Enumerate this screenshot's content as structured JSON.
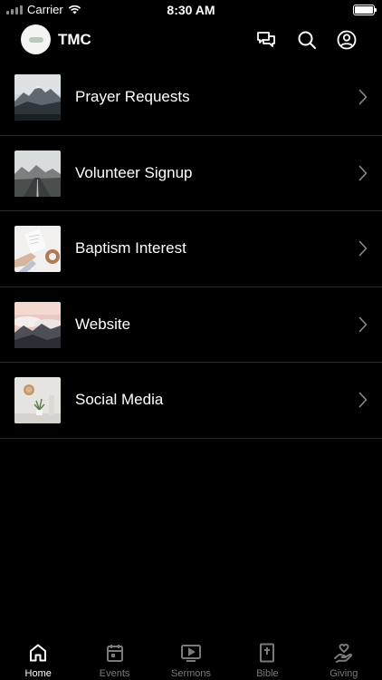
{
  "status_bar": {
    "carrier": "Carrier",
    "time": "8:30 AM",
    "icons": [
      "signal-icon",
      "wifi-icon",
      "battery-icon"
    ]
  },
  "header": {
    "title": "TMC",
    "icons": [
      "messages-icon",
      "search-icon",
      "profile-icon"
    ]
  },
  "list": [
    {
      "label": "Prayer Requests",
      "image": "mountain-landscape-photo"
    },
    {
      "label": "Volunteer Signup",
      "image": "road-landscape-photo"
    },
    {
      "label": "Baptism Interest",
      "image": "hands-writing-photo"
    },
    {
      "label": "Website",
      "image": "cloudy-mountain-photo"
    },
    {
      "label": "Social Media",
      "image": "plant-and-clock-photo"
    }
  ],
  "tabbar": {
    "active": "Home",
    "tabs": [
      {
        "label": "Home",
        "icon": "home-icon"
      },
      {
        "label": "Events",
        "icon": "calendar-icon"
      },
      {
        "label": "Sermons",
        "icon": "video-icon"
      },
      {
        "label": "Bible",
        "icon": "bible-icon"
      },
      {
        "label": "Giving",
        "icon": "giving-hand-icon"
      }
    ]
  },
  "colors": {
    "background": "#000000",
    "text": "#ffffff",
    "divider": "#2b2b2b",
    "inactive_tab": "#7a7a7a"
  }
}
